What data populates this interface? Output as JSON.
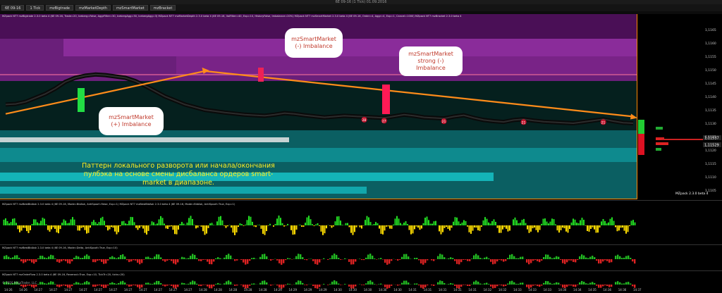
{
  "window": {
    "title": "6E 09-16 (1 Tick) 01.09.2016"
  },
  "toolbar": {
    "instrument": "6E 09-16",
    "timeframe": "1 Tick",
    "tabs": [
      "mzBigtrade",
      "mzMarketDepth",
      "mzSmartMarket",
      "mzBracket"
    ]
  },
  "header_indicators_text": "MZpack NT7 mzBigtrade 2.3.0 beta 4 (6E 09-16, Trade=20, Iceberg=False, AggrFilter=30, IcebergAgg=30, IcebergAgg=3) MZpack NT7 mzMarketDepth 2.3.0 beta 4 (6E 09-16, VolFilter=40, Exp=10, HistoryFalse, Imbalance=20%) MZpack NT7 mzSmartMarket 2.3.0 beta 4 (6E 09-16, Order=4, Aggr=4, Exp=1, Cancel=1000) MZpack NT7 mzBracket 2.3.0 beta 4",
  "callouts": {
    "plus_imbalance": "mzSmartMarket\n(+) Imbalance",
    "minus_imbalance": "mzSmartMarket\n(-) Imbalance",
    "strong_minus": "mzSmartMarket\nstrong (-)\nImbalance"
  },
  "note": "Паттерн локального разворота или начала/окончания пулбэка на основе смены дисбаланса ордеров smart-market в диапазоне.",
  "badge": "MZpack 2.3.0 beta 4",
  "panels": {
    "bidask": "MZpack NT7 mzBestBidAsk 2.3.0 beta 4 (6E 09-16, Mode=BidAsk, AntiSpoof=False, Exp=1) MZpack NT7 mzBestBidAsk 2.3.0 beta 4 (6E 09-16, Mode=BidAsk, AntiSpoof=True, Exp=1)",
    "delta": "MZpack NT7 mzBestBidAsk 2.3.0 beta 4 (6E 09-16, Mode=Delta, AntiSpoof=True, Exp=10)",
    "orderflow": "MZpack NT7 mzOrderFlow 2.3.0 beta 4 (6E 09-16, Reversal=True, Exp=10, TickTr=20, ticks=20)"
  },
  "copyright": "© 2016 NinjaTrader, LLC",
  "chart_data": {
    "type": "line",
    "title": "",
    "xlabel": "",
    "ylabel": "",
    "price_axis_labels": [
      "1,1165",
      "1,1160",
      "1,1155",
      "1,1150",
      "1,1145",
      "1,1140",
      "1,1135",
      "1,1130",
      "1,1125",
      "1,1120",
      "1,1115",
      "1,1110",
      "1,1105"
    ],
    "price_axis_values": [
      1.1165,
      1.116,
      1.1155,
      1.115,
      1.1145,
      1.114,
      1.1135,
      1.113,
      1.1125,
      1.112,
      1.1115,
      1.111,
      1.1105
    ],
    "time_axis_labels": [
      "14:26",
      "14:26",
      "14:27",
      "14:27",
      "14:27",
      "14:27",
      "14:27",
      "14:27",
      "14:27",
      "14:27",
      "14:27",
      "14:27",
      "14:27",
      "14:28",
      "14:28",
      "14:28",
      "14:28",
      "14:28",
      "14:29",
      "14:29",
      "14:29",
      "14:29",
      "14:30",
      "14:30",
      "14:30",
      "14:30",
      "14:30",
      "14:31",
      "14:31",
      "14:31",
      "14:31",
      "14:31",
      "14:32",
      "14:32",
      "14:33",
      "14:33",
      "14:33",
      "14:34",
      "14:34",
      "14:35",
      "14:36",
      "14:36",
      "14:37"
    ],
    "last_price_labels": [
      "1,11537",
      "1,11529"
    ],
    "price_series": [
      1.1137,
      1.11372,
      1.1138,
      1.11395,
      1.1141,
      1.1143,
      1.11455,
      1.1147,
      1.11478,
      1.11482,
      1.1148,
      1.11475,
      1.1147,
      1.11458,
      1.1144,
      1.1142,
      1.114,
      1.11385,
      1.1137,
      1.1136,
      1.1135,
      1.11345,
      1.1134,
      1.11336,
      1.11332,
      1.1133,
      1.11328,
      1.11332,
      1.11338,
      1.11335,
      1.1133,
      1.11326,
      1.11322,
      1.11325,
      1.11328,
      1.11326,
      1.11324,
      1.11322,
      1.1132,
      1.11326,
      1.11332,
      1.11328,
      1.11322,
      1.1132,
      1.11318,
      1.11325,
      1.1133,
      1.1132,
      1.11312,
      1.11308,
      1.11305,
      1.11312,
      1.11315,
      1.1131,
      1.11306,
      1.11304,
      1.11302,
      1.113,
      1.11305,
      1.1131,
      1.11315,
      1.11308,
      1.11302,
      1.113
    ],
    "trend_lines": [
      {
        "name": "up",
        "from": [
          0,
          1.11335
        ],
        "to": [
          20,
          1.11495
        ]
      },
      {
        "name": "down",
        "from": [
          20,
          1.11495
        ],
        "to": [
          63,
          1.11325
        ]
      }
    ],
    "markers": [
      "28",
      "27",
      "21",
      "21",
      "21"
    ],
    "grid": false,
    "legend": "none"
  }
}
